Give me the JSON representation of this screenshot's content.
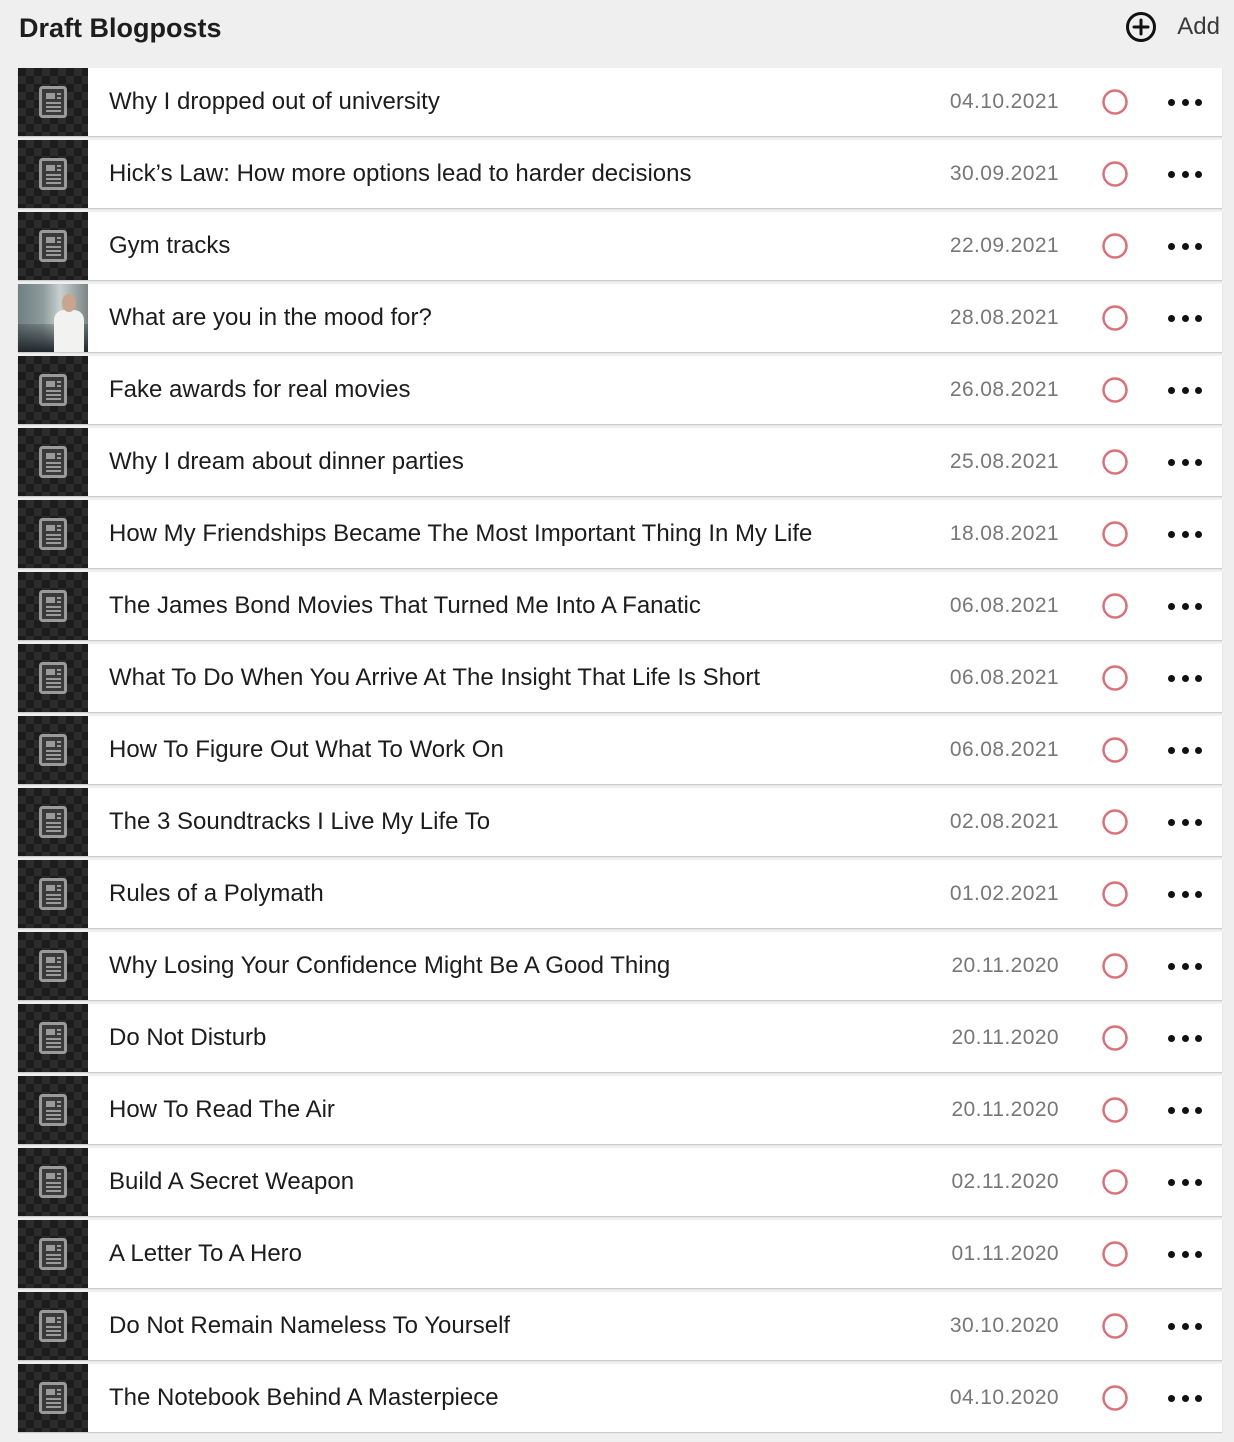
{
  "header": {
    "title": "Draft Blogposts",
    "add_label": "Add",
    "add_icon": "plus-circle-icon"
  },
  "colors": {
    "status_ring": "#d9707a",
    "background": "#efefef",
    "thumbnail_dark": "#1c1c1c"
  },
  "posts": [
    {
      "title": "Why I dropped out of university",
      "date": "04.10.2021",
      "thumbnail": "document-icon"
    },
    {
      "title": "Hick’s Law: How more options lead to harder decisions",
      "date": "30.09.2021",
      "thumbnail": "document-icon"
    },
    {
      "title": "Gym tracks",
      "date": "22.09.2021",
      "thumbnail": "document-icon"
    },
    {
      "title": "What are you in the mood for?",
      "date": "28.08.2021",
      "thumbnail": "photo"
    },
    {
      "title": "Fake awards for real movies",
      "date": "26.08.2021",
      "thumbnail": "document-icon"
    },
    {
      "title": "Why I dream about dinner parties",
      "date": "25.08.2021",
      "thumbnail": "document-icon"
    },
    {
      "title": "How My Friendships Became The Most Important Thing In My Life",
      "date": "18.08.2021",
      "thumbnail": "document-icon"
    },
    {
      "title": "The James Bond Movies That Turned Me Into A Fanatic",
      "date": "06.08.2021",
      "thumbnail": "document-icon"
    },
    {
      "title": "What To Do When You Arrive At The Insight That Life Is Short",
      "date": "06.08.2021",
      "thumbnail": "document-icon"
    },
    {
      "title": "How To Figure Out What To Work On",
      "date": "06.08.2021",
      "thumbnail": "document-icon"
    },
    {
      "title": "The 3 Soundtracks I Live My Life To",
      "date": "02.08.2021",
      "thumbnail": "document-icon"
    },
    {
      "title": "Rules of a Polymath",
      "date": "01.02.2021",
      "thumbnail": "document-icon"
    },
    {
      "title": "Why Losing Your Confidence Might Be A Good Thing",
      "date": "20.11.2020",
      "thumbnail": "document-icon"
    },
    {
      "title": "Do Not Disturb",
      "date": "20.11.2020",
      "thumbnail": "document-icon"
    },
    {
      "title": "How To Read The Air",
      "date": "20.11.2020",
      "thumbnail": "document-icon"
    },
    {
      "title": "Build A Secret Weapon",
      "date": "02.11.2020",
      "thumbnail": "document-icon"
    },
    {
      "title": "A Letter To A Hero",
      "date": "01.11.2020",
      "thumbnail": "document-icon"
    },
    {
      "title": "Do Not Remain Nameless To Yourself",
      "date": "30.10.2020",
      "thumbnail": "document-icon"
    },
    {
      "title": "The Notebook Behind A Masterpiece",
      "date": "04.10.2020",
      "thumbnail": "document-icon"
    }
  ]
}
